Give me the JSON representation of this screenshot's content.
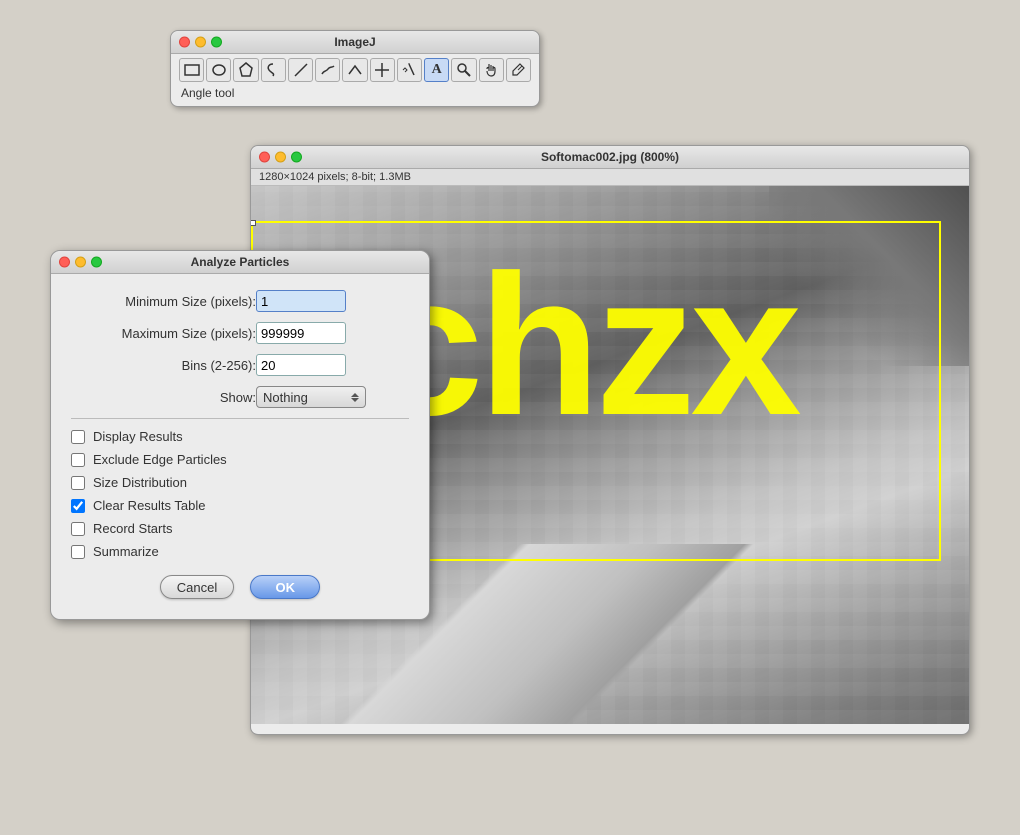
{
  "imagej_toolbar": {
    "title": "ImageJ",
    "active_tool": "Angle tool",
    "tools": [
      {
        "name": "rectangle-tool",
        "icon": "▭",
        "label": "Rectangle"
      },
      {
        "name": "oval-tool",
        "icon": "○",
        "label": "Oval"
      },
      {
        "name": "polygon-tool",
        "icon": "⬠",
        "label": "Polygon"
      },
      {
        "name": "freehand-tool",
        "icon": "♡",
        "label": "Freehand"
      },
      {
        "name": "line-tool",
        "icon": "╲",
        "label": "Line"
      },
      {
        "name": "freeline-tool",
        "icon": "∿",
        "label": "Freeline"
      },
      {
        "name": "angle-tool",
        "icon": "∧",
        "label": "Angle"
      },
      {
        "name": "crosshair-tool",
        "icon": "✛",
        "label": "Crosshair"
      },
      {
        "name": "wand-tool",
        "icon": "✦",
        "label": "Wand"
      },
      {
        "name": "text-tool",
        "icon": "A",
        "label": "Text"
      },
      {
        "name": "magnifier-tool",
        "icon": "🔍",
        "label": "Magnifier"
      },
      {
        "name": "hand-tool",
        "icon": "✋",
        "label": "Scrolling"
      },
      {
        "name": "dropper-tool",
        "icon": "✒",
        "label": "Color Picker"
      }
    ],
    "active_tool_label": "Angle tool"
  },
  "image_window": {
    "title": "Softomac002.jpg (800%)",
    "info": "1280×1024 pixels; 8-bit; 1.3MB",
    "zoom": "800%",
    "content_text": "j  chzx"
  },
  "dialog": {
    "title": "Analyze Particles",
    "fields": {
      "minimum_size_label": "Minimum Size (pixels):",
      "minimum_size_value": "1",
      "maximum_size_label": "Maximum Size (pixels):",
      "maximum_size_value": "999999",
      "bins_label": "Bins (2-256):",
      "bins_value": "20",
      "show_label": "Show:",
      "show_value": "Nothing"
    },
    "checkboxes": [
      {
        "name": "display-results",
        "label": "Display Results",
        "checked": false
      },
      {
        "name": "exclude-edge",
        "label": "Exclude Edge Particles",
        "checked": false
      },
      {
        "name": "size-distribution",
        "label": "Size Distribution",
        "checked": false
      },
      {
        "name": "clear-results",
        "label": "Clear Results Table",
        "checked": true
      },
      {
        "name": "record-starts",
        "label": "Record Starts",
        "checked": false
      },
      {
        "name": "summarize",
        "label": "Summarize",
        "checked": false
      }
    ],
    "buttons": {
      "cancel": "Cancel",
      "ok": "OK"
    }
  }
}
